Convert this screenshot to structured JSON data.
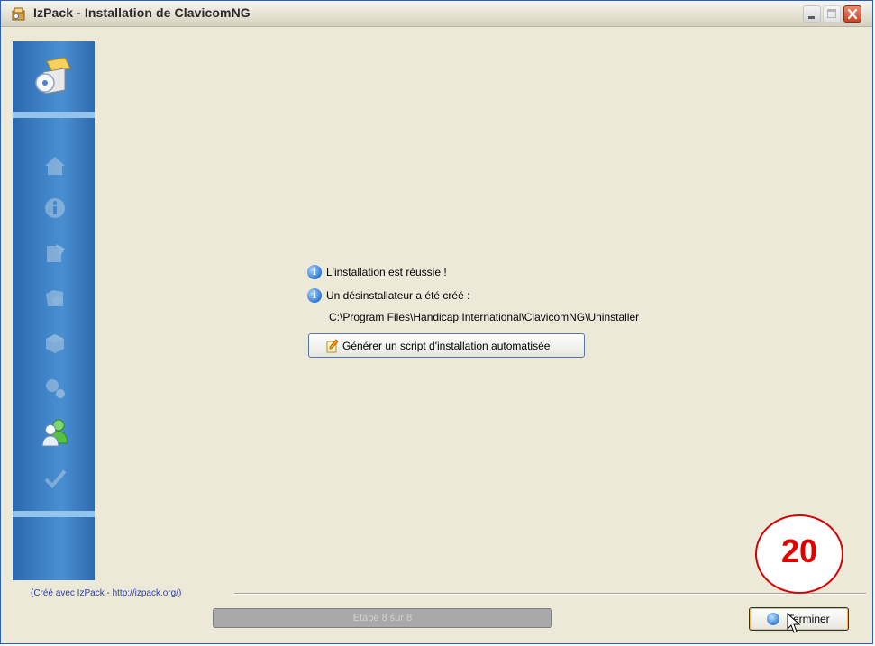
{
  "window": {
    "title": "IzPack - Installation de ClavicomNG"
  },
  "messages": {
    "success": "L'installation est réussie !",
    "uninstaller_created": "Un désinstallateur a été créé :",
    "uninstaller_path": "C:\\Program Files\\Handicap International\\ClavicomNG\\Uninstaller"
  },
  "buttons": {
    "generate_script": "Générer un script d'installation automatisée",
    "finish": "Terminer"
  },
  "footer": {
    "credit": "(Créé avec IzPack - http://izpack.org/)",
    "progress_text": "Etape 8 sur 8",
    "progress_value": 8,
    "progress_max": 8
  },
  "annotation": {
    "number": "20"
  },
  "sidebar": {
    "steps": [
      {
        "icon": "installer-box-icon",
        "active": true
      },
      {
        "icon": "home-icon",
        "active": false
      },
      {
        "icon": "info-icon",
        "active": false
      },
      {
        "icon": "license-icon",
        "active": false
      },
      {
        "icon": "target-folder-icon",
        "active": false
      },
      {
        "icon": "packages-icon",
        "active": false
      },
      {
        "icon": "gears-icon",
        "active": false
      },
      {
        "icon": "users-icon",
        "active": true
      },
      {
        "icon": "checkmark-icon",
        "active": false
      }
    ]
  },
  "colors": {
    "sidebar_blue": "#3f84c8",
    "annotation_red": "#e00000",
    "credit_blue": "#2a3ea8"
  }
}
